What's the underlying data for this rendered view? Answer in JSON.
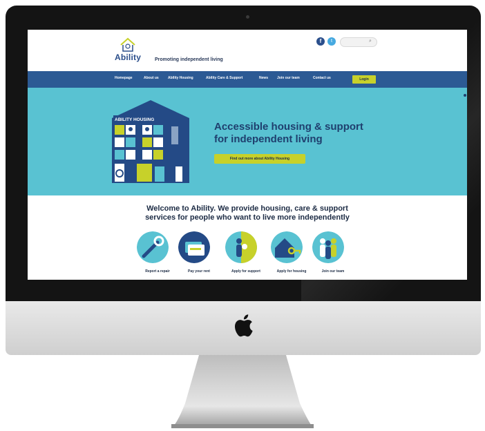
{
  "site": {
    "logo_text": "Ability",
    "tagline": "Promoting independent living"
  },
  "header": {
    "facebook_glyph": "f",
    "twitter_glyph": "t",
    "search_placeholder": ""
  },
  "nav": {
    "items": [
      "Homepage",
      "About us",
      "Ability Housing",
      "Ability Care & Support",
      "News",
      "Join our team",
      "Contact us"
    ],
    "login_label": "Login"
  },
  "hero": {
    "illustration_label": "ABILITY HOUSING",
    "title_line1": "Accessible housing & support",
    "title_line2": "for independent living",
    "button_label": "Find out more about Ability Housing"
  },
  "welcome": {
    "line1": "Welcome to Ability. We provide housing, care & support",
    "line2": "services for people who want to live more independently"
  },
  "services": [
    {
      "label": "Report a repair",
      "icon": "wrench-icon"
    },
    {
      "label": "Pay your rent",
      "icon": "card-icon"
    },
    {
      "label": "Apply for support",
      "icon": "person-support-icon"
    },
    {
      "label": "Apply for housing",
      "icon": "house-key-icon"
    },
    {
      "label": "Join our team",
      "icon": "team-icon"
    }
  ],
  "colors": {
    "nav_blue": "#2c5a94",
    "hero_teal": "#59c2d2",
    "accent_lime": "#c7d12a",
    "dark_navy": "#1f3f6e"
  }
}
